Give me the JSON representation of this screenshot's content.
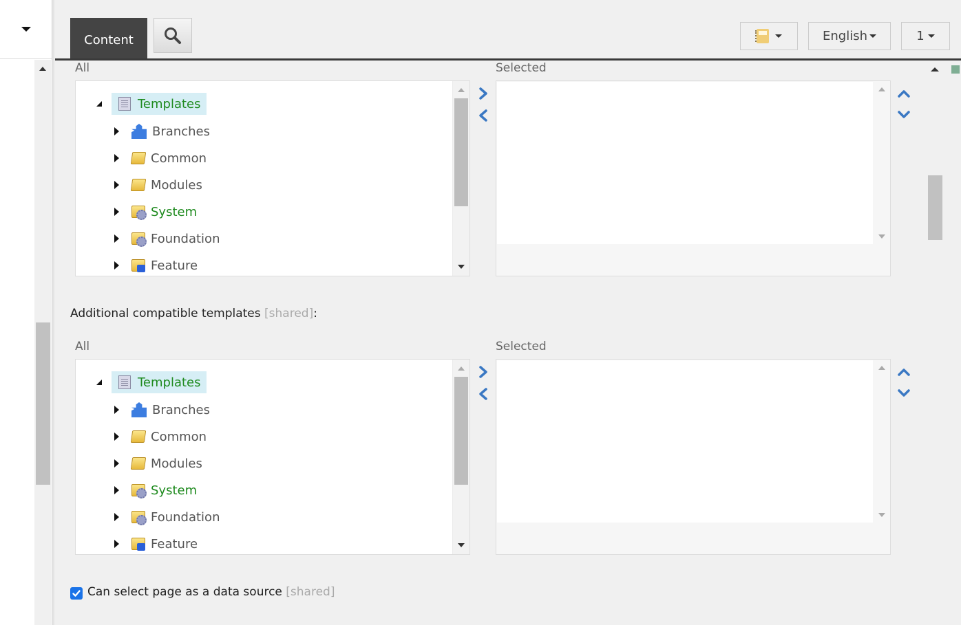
{
  "left_panel": {
    "collapse_icon": "caret-down-icon"
  },
  "header": {
    "tabs": [
      {
        "label": "Content",
        "active": true
      }
    ],
    "search_icon": "search-icon",
    "buttons": [
      {
        "name": "bookmark-dropdown",
        "icon": "notebook-icon"
      },
      {
        "name": "language-dropdown",
        "label": "English"
      },
      {
        "name": "version-dropdown",
        "label": "1"
      }
    ]
  },
  "section1": {
    "all_label": "All",
    "selected_label": "Selected",
    "tree": {
      "root": {
        "label": "Templates",
        "icon": "template-icon",
        "expanded": true
      },
      "children": [
        {
          "label": "Branches",
          "icon": "puzzle-icon",
          "color": "#555555"
        },
        {
          "label": "Common",
          "icon": "folder-icon",
          "color": "#555555"
        },
        {
          "label": "Modules",
          "icon": "folder-icon",
          "color": "#555555"
        },
        {
          "label": "System",
          "icon": "gear-folder-icon",
          "color": "#1e8a1e"
        },
        {
          "label": "Foundation",
          "icon": "gear-folder-icon",
          "color": "#555555"
        },
        {
          "label": "Feature",
          "icon": "feature-folder-icon",
          "color": "#555555"
        }
      ]
    },
    "selected_items": []
  },
  "section2": {
    "title": "Additional compatible templates",
    "shared_tag": "[shared]",
    "title_suffix": ":",
    "all_label": "All",
    "selected_label": "Selected",
    "tree": {
      "root": {
        "label": "Templates",
        "icon": "template-icon",
        "expanded": true
      },
      "children": [
        {
          "label": "Branches",
          "icon": "puzzle-icon",
          "color": "#555555"
        },
        {
          "label": "Common",
          "icon": "folder-icon",
          "color": "#555555"
        },
        {
          "label": "Modules",
          "icon": "folder-icon",
          "color": "#555555"
        },
        {
          "label": "System",
          "icon": "gear-folder-icon",
          "color": "#1e8a1e"
        },
        {
          "label": "Foundation",
          "icon": "gear-folder-icon",
          "color": "#555555"
        },
        {
          "label": "Feature",
          "icon": "feature-folder-icon",
          "color": "#555555"
        }
      ]
    },
    "selected_items": []
  },
  "checkbox": {
    "label": "Can select page as a data source",
    "shared_tag": "[shared]",
    "checked": true
  },
  "colors": {
    "accent_blue": "#3a78c3",
    "tab_dark": "#444444",
    "tree_highlight": "#d6eef5",
    "green_text": "#1e8a1e",
    "checkbox_blue": "#1a73e8"
  }
}
